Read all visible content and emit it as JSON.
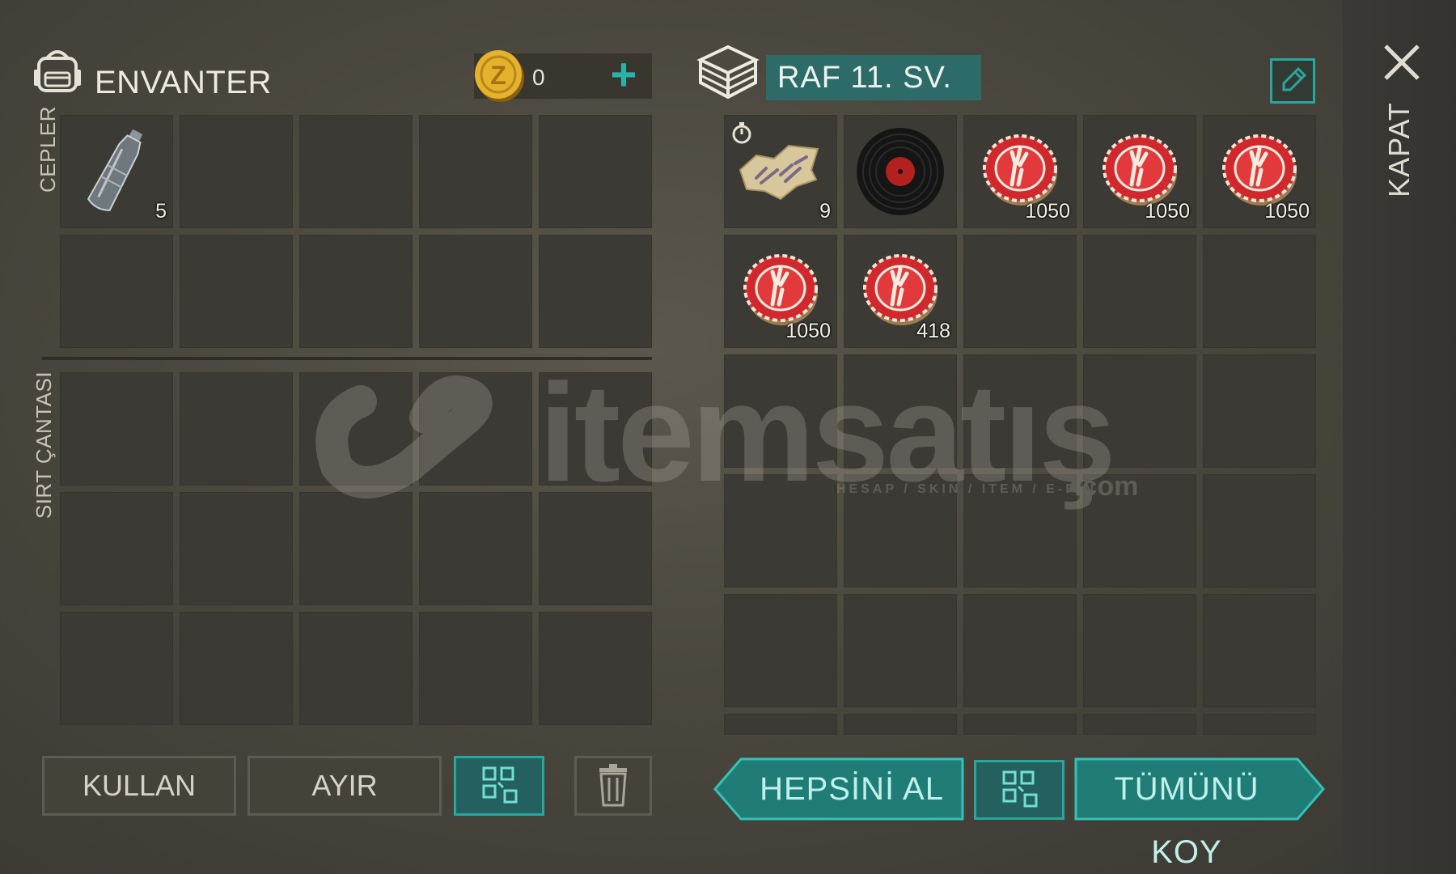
{
  "inventory": {
    "title": "ENVANTER",
    "currency_value": "0",
    "pockets_label": "CEPLER",
    "backpack_label": "SIRT ÇANTASI",
    "pocket_items": [
      {
        "icon": "plastic-bottle-icon",
        "qty": "5"
      }
    ]
  },
  "shelf": {
    "name": "RAF 11. SV.",
    "items": [
      {
        "icon": "map-fragment-icon",
        "qty": "9"
      },
      {
        "icon": "vinyl-record-icon",
        "qty": ""
      },
      {
        "icon": "bottle-cap-icon",
        "qty": "1050"
      },
      {
        "icon": "bottle-cap-icon",
        "qty": "1050"
      },
      {
        "icon": "bottle-cap-icon",
        "qty": "1050"
      },
      {
        "icon": "bottle-cap-icon",
        "qty": "1050"
      },
      {
        "icon": "bottle-cap-icon",
        "qty": "418"
      }
    ]
  },
  "close_label": "KAPAT",
  "buttons": {
    "use": "KULLAN",
    "split": "AYIR",
    "take_all": "HEPSİNİ AL",
    "put_all": "TÜMÜNÜ KOY"
  },
  "watermark": {
    "brand": "itemsatış",
    "tagline": "HESAP / SKIN / ITEM / E-PIN",
    "tld": ".com"
  },
  "colors": {
    "accent_teal": "#27a89f",
    "cap_red": "#d0282c",
    "coin_gold": "#e4b22b"
  }
}
